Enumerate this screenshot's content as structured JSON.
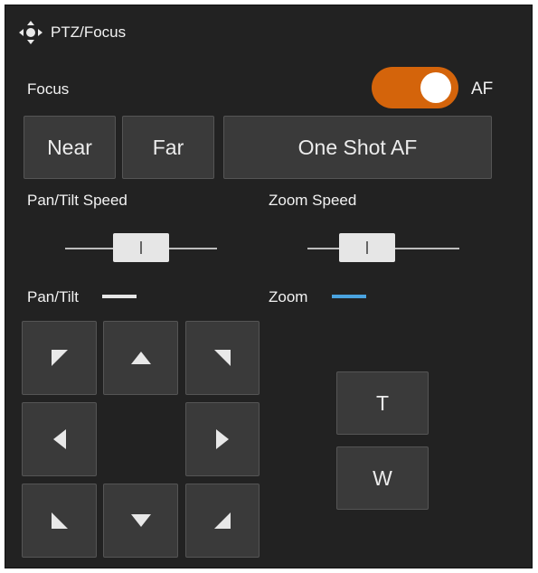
{
  "header": {
    "title": "PTZ/Focus",
    "icon": "pan-tilt-move-icon"
  },
  "focus": {
    "label": "Focus",
    "af_label": "AF",
    "af_enabled": true,
    "near_label": "Near",
    "far_label": "Far",
    "one_shot_label": "One Shot AF",
    "toggle_color": "#d4640b"
  },
  "speeds": {
    "pan_tilt_label": "Pan/Tilt Speed",
    "zoom_label": "Zoom Speed",
    "pan_tilt_value": 0.5,
    "zoom_value": 0.33
  },
  "pan_tilt": {
    "label": "Pan/Tilt",
    "indicator_color": "#e6e6e6",
    "buttons": [
      "up-left",
      "up",
      "up-right",
      "left",
      "right",
      "down-left",
      "down",
      "down-right"
    ]
  },
  "zoom": {
    "label": "Zoom",
    "indicator_color": "#4aa3df",
    "tele_label": "T",
    "wide_label": "W"
  }
}
